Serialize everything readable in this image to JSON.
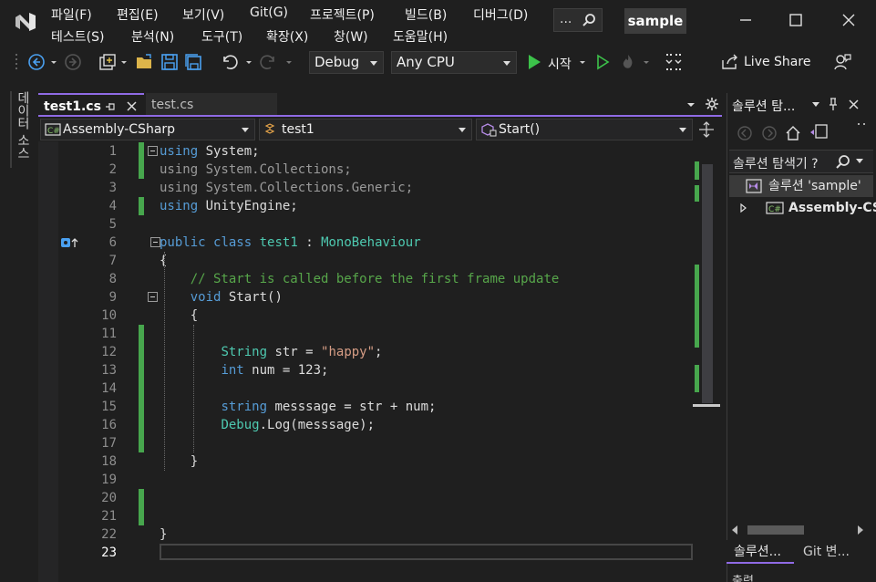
{
  "menu": {
    "row1": [
      "파일(F)",
      "편집(E)",
      "보기(V)",
      "Git(G)",
      "프로젝트(P)",
      "빌드(B)",
      "디버그(D)"
    ],
    "row2": [
      "테스트(S)",
      "분석(N)",
      "도구(T)",
      "확장(X)",
      "창(W)",
      "도움말(H)"
    ],
    "search_text": "...",
    "solution_name": "sample"
  },
  "toolbar": {
    "config": "Debug",
    "platform": "Any CPU",
    "start_label": "시작",
    "live_share": "Live Share"
  },
  "left_strip": {
    "data_sources": "데이터 소스"
  },
  "tabs": [
    {
      "label": "test1.cs",
      "active": true
    },
    {
      "label": "test.cs",
      "active": false
    }
  ],
  "navbar": {
    "project": "Assembly-CSharp",
    "class": "test1",
    "member": "Start()"
  },
  "code": {
    "lines": [
      {
        "num": "1",
        "html": "<span class='kw'>using</span> System;"
      },
      {
        "num": "2",
        "html": "<span style='color:#9a9a9a'>using System.Collections;</span>"
      },
      {
        "num": "3",
        "html": "<span style='color:#9a9a9a'>using System.Collections.Generic;</span>"
      },
      {
        "num": "4",
        "html": "<span class='kw'>using</span> UnityEngine;"
      },
      {
        "num": "5",
        "html": ""
      },
      {
        "num": "6",
        "html": "<span class='kw'>public</span> <span class='kw'>class</span> <span class='ty'>test1</span> : <span class='ty'>MonoBehaviour</span>"
      },
      {
        "num": "7",
        "html": "{"
      },
      {
        "num": "8",
        "html": "    <span class='cm'>// Start is called before the first frame update</span>"
      },
      {
        "num": "9",
        "html": "    <span class='kw'>void</span> Start()"
      },
      {
        "num": "10",
        "html": "    {"
      },
      {
        "num": "11",
        "html": ""
      },
      {
        "num": "12",
        "html": "        <span class='ty'>String</span> str = <span class='st'>\"happy\"</span>;"
      },
      {
        "num": "13",
        "html": "        <span class='kw'>int</span> num = 123;"
      },
      {
        "num": "14",
        "html": ""
      },
      {
        "num": "15",
        "html": "        <span class='kw'>string</span> messsage = str + num;"
      },
      {
        "num": "16",
        "html": "        <span class='ty'>Debug</span>.Log(messsage);"
      },
      {
        "num": "17",
        "html": ""
      },
      {
        "num": "18",
        "html": "    }"
      },
      {
        "num": "19",
        "html": ""
      },
      {
        "num": "20",
        "html": ""
      },
      {
        "num": "21",
        "html": ""
      },
      {
        "num": "22",
        "html": "}"
      },
      {
        "num": "23",
        "html": ""
      }
    ],
    "changed_lines": [
      1,
      2,
      4,
      11,
      12,
      13,
      14,
      15,
      16,
      17,
      20,
      21
    ],
    "fold_lines": [
      1,
      6,
      9
    ],
    "current_line": 23
  },
  "solution_explorer": {
    "title": "솔루션 탐...",
    "search_label": "솔루션 탐색기 ?",
    "solution_item": "솔루션 'sample'",
    "project_item": "Assembly-CS",
    "tab_solution": "솔루션...",
    "tab_git": "Git 변...",
    "output_title": "출력"
  },
  "colors": {
    "accent": "#8f6ae4",
    "change_bar": "#47a64d",
    "keyword": "#569cd6",
    "type": "#4ec9b0"
  }
}
